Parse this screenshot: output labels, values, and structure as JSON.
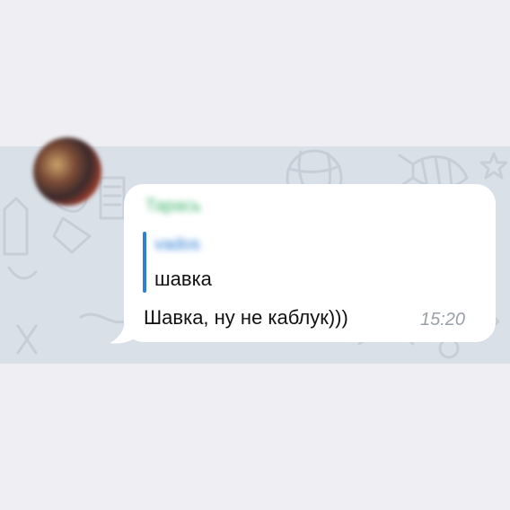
{
  "chat": {
    "background_color": "#d9e0e8",
    "message": {
      "sender_name": "Тарась",
      "reply": {
        "author": "vados",
        "text": "шавка"
      },
      "text": "Шавка, ну не каблук)))",
      "time": "15:20"
    },
    "avatar_icon": "user-avatar-blurred"
  }
}
